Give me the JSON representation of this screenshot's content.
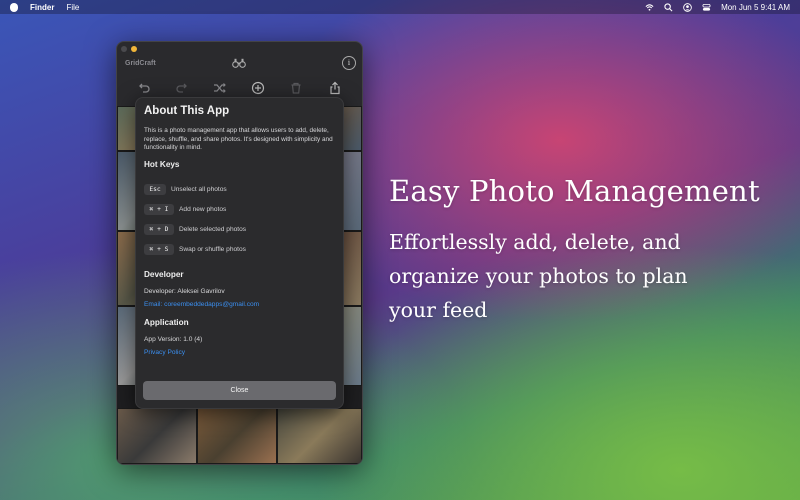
{
  "menubar": {
    "app": "Finder",
    "file": "File",
    "datetime": "Mon Jun 5  9:41 AM"
  },
  "window": {
    "title": "GridCraft",
    "icons": [
      "binoculars-icon",
      "info-icon"
    ],
    "toolbar_icons": [
      "undo-icon",
      "redo-icon",
      "shuffle-icon",
      "add-icon",
      "trash-icon",
      "share-icon"
    ]
  },
  "about": {
    "title": "About This App",
    "description": "This is a photo management app that allows users to add, delete, replace, shuffle, and share photos. It's designed with simplicity and functionality in mind.",
    "hotkeys_heading": "Hot Keys",
    "hotkeys": [
      {
        "key": "Esc",
        "desc": "Unselect all photos"
      },
      {
        "key": "⌘ + I",
        "desc": "Add new photos"
      },
      {
        "key": "⌘ + D",
        "desc": "Delete selected photos"
      },
      {
        "key": "⌘ + S",
        "desc": "Swap or shuffle photos"
      }
    ],
    "developer_heading": "Developer",
    "developer": "Developer: Aleksei Gavrilov",
    "email": "Email: coreembeddedapps@gmail.com",
    "application_heading": "Application",
    "version": "App Version: 1.0 (4)",
    "privacy": "Privacy Policy",
    "close": "Close"
  },
  "marketing": {
    "headline": "Easy Photo Management",
    "sub_lines": [
      "Effortlessly add, delete, and",
      "organize your photos to plan",
      "your feed"
    ]
  },
  "colors": {
    "link": "#3b8ff0",
    "window_bg": "#2a2a2d",
    "traffic_yellow": "#f1b63a"
  }
}
